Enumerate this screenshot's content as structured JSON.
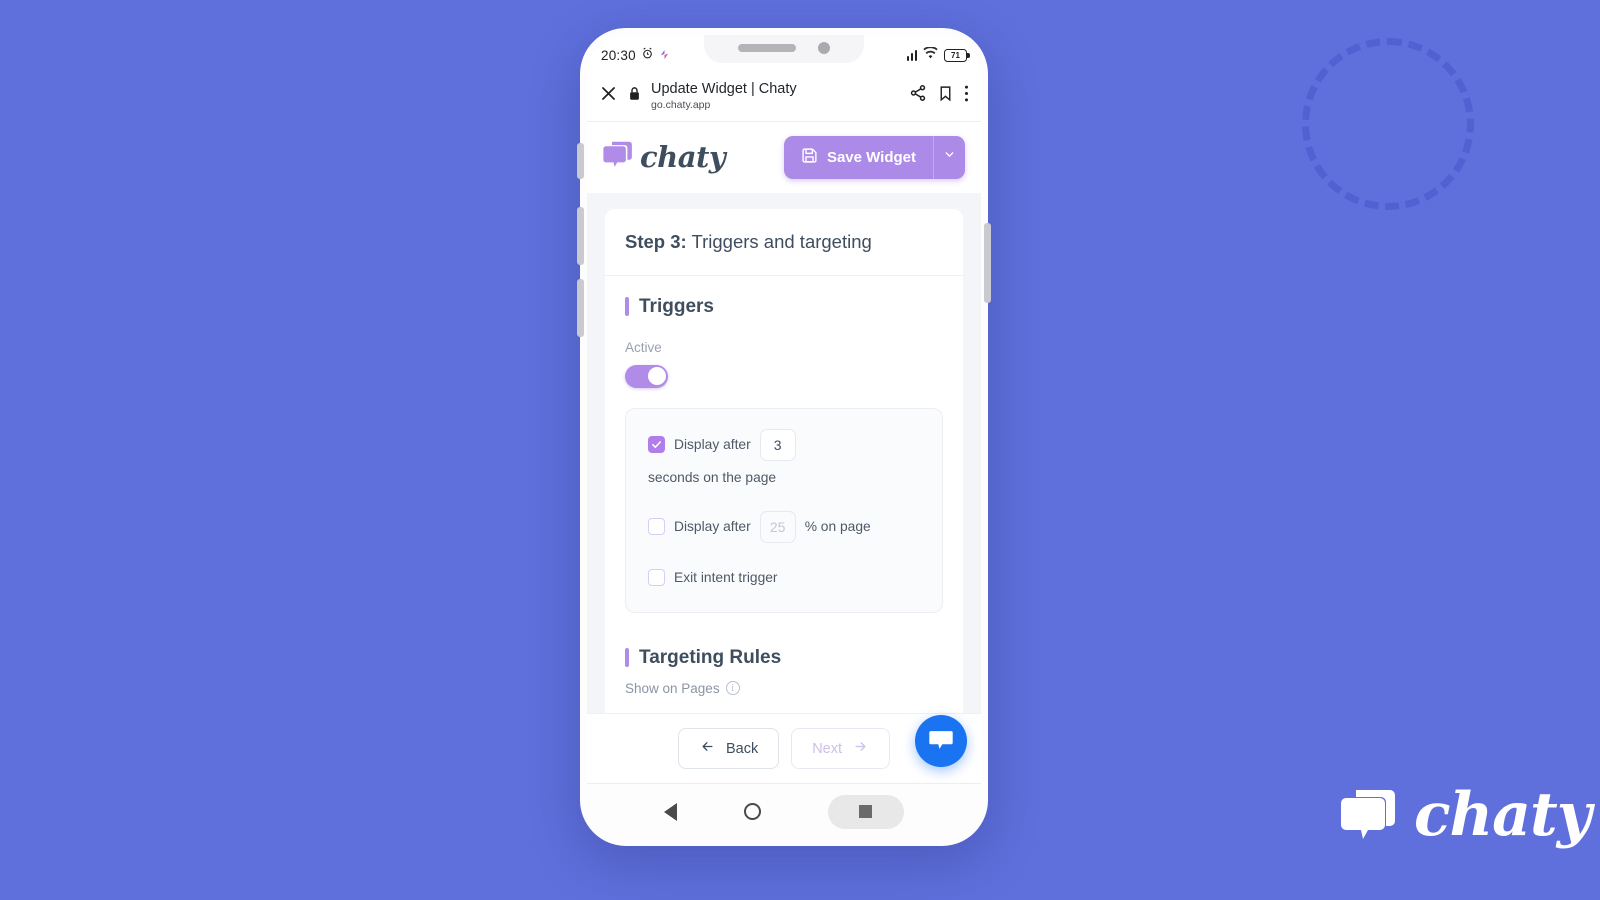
{
  "background": {
    "color": "#5f6fdb",
    "accent_circle_color": "#4f60d2"
  },
  "watermark": {
    "brand": "chaty",
    "icon": "chat-bubbles-icon"
  },
  "phone": {
    "status_bar": {
      "time": "20:30",
      "alarm_icon": "alarm-clock-icon",
      "app_icon": "app-notification-icon",
      "signal_icon": "signal-bars-icon",
      "wifi_icon": "wifi-icon",
      "battery_level": "71"
    },
    "browser_bar": {
      "close_icon": "close-icon",
      "lock_icon": "lock-icon",
      "title": "Update Widget | Chaty",
      "url": "go.chaty.app",
      "share_icon": "share-icon",
      "bookmark_icon": "bookmark-icon",
      "menu_icon": "more-vertical-icon"
    },
    "android_nav": {
      "back_icon": "triangle-back-icon",
      "home_icon": "circle-home-icon",
      "recents_icon": "square-recents-icon"
    }
  },
  "app_header": {
    "logo_icon": "chat-bubbles-icon",
    "logo_text": "chaty",
    "save_button": {
      "label": "Save Widget",
      "icon": "save-floppy-icon",
      "dropdown_icon": "chevron-down-icon",
      "color": "#ab8ae8"
    }
  },
  "main": {
    "step_prefix": "Step 3:",
    "step_title": " Triggers and targeting",
    "triggers": {
      "heading": "Triggers",
      "active_label": "Active",
      "active_state": "on",
      "rows": [
        {
          "checked": true,
          "text_before": "Display after",
          "value": "3",
          "placeholder": "3",
          "text_after": "seconds on the page"
        },
        {
          "checked": false,
          "text_before": "Display after",
          "value": "",
          "placeholder": "25",
          "text_after": "% on page"
        },
        {
          "checked": false,
          "text_before": "Exit intent trigger",
          "value": null,
          "placeholder": "",
          "text_after": ""
        }
      ]
    },
    "targeting": {
      "heading": "Targeting Rules",
      "show_on_pages_label": "Show on Pages",
      "info_icon": "info-icon"
    }
  },
  "footer": {
    "back_label": "Back",
    "back_icon": "arrow-left-icon",
    "next_label": "Next",
    "next_icon": "arrow-right-icon",
    "next_disabled": true,
    "chat_widget_icon": "chat-bubble-icon",
    "chat_widget_color": "#1a73f0"
  }
}
